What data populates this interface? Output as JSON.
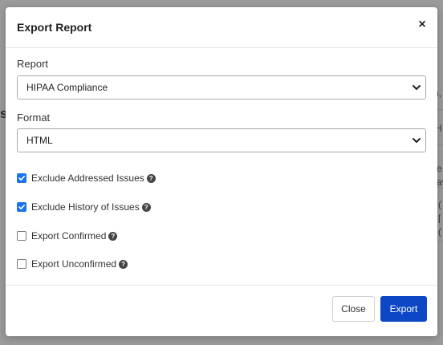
{
  "background": {
    "left_fragment": "sc",
    "right_fragments": [
      "n,",
      "H",
      "e",
      "av",
      "(",
      "[",
      "("
    ]
  },
  "modal": {
    "title": "Export Report",
    "close_icon": "×",
    "report": {
      "label": "Report",
      "selected": "HIPAA Compliance"
    },
    "format": {
      "label": "Format",
      "selected": "HTML"
    },
    "options": [
      {
        "label": "Exclude Addressed Issues",
        "checked": true,
        "help_icon": "question-circle-icon"
      },
      {
        "label": "Exclude History of Issues",
        "checked": true,
        "help_icon": "question-circle-icon"
      },
      {
        "label": "Export Confirmed",
        "checked": false,
        "help_icon": "question-circle-icon"
      },
      {
        "label": "Export Unconfirmed",
        "checked": false,
        "help_icon": "question-circle-icon"
      }
    ],
    "help_glyph": "?",
    "buttons": {
      "close_label": "Close",
      "export_label": "Export"
    }
  },
  "colors": {
    "accent": "#0d47c6",
    "checkbox_checked": "#1a73e8",
    "backdrop": "#9b9b9b"
  }
}
